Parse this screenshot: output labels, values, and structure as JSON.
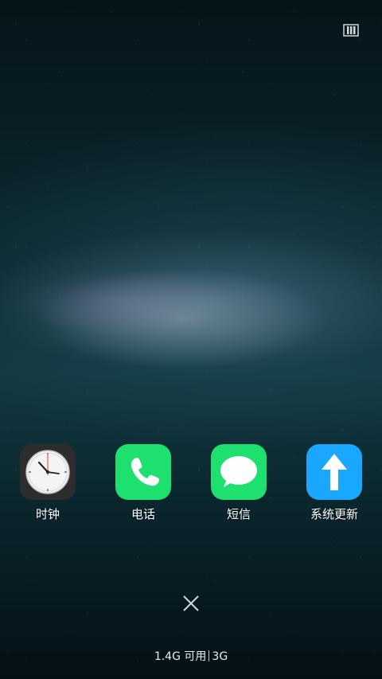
{
  "recents": {
    "apps": [
      {
        "label": "时钟",
        "icon": "clock-icon"
      },
      {
        "label": "电话",
        "icon": "phone-icon",
        "color": "#1ee06e"
      },
      {
        "label": "短信",
        "icon": "message-icon",
        "color": "#1ee06e"
      },
      {
        "label": "系统更新",
        "icon": "upload-arrow-icon",
        "color": "#1aa7ff"
      }
    ],
    "manage_icon": "view-mode-icon",
    "close_icon": "close-icon"
  },
  "memory": {
    "available": "1.4G 可用",
    "total": "3G"
  }
}
